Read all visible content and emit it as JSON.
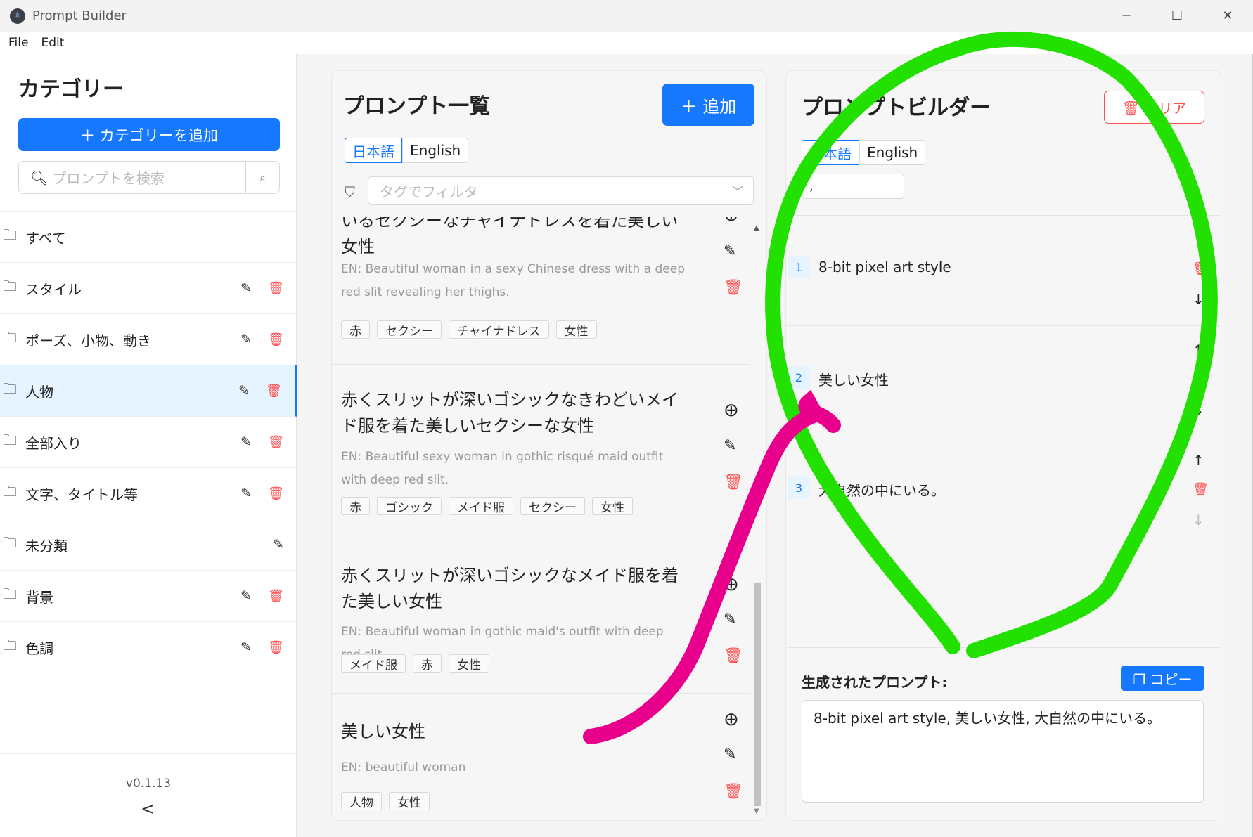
{
  "window": {
    "title": "Prompt Builder",
    "min": "─",
    "max": "☐",
    "close": "✕"
  },
  "menu": [
    "File",
    "Edit"
  ],
  "sidebar": {
    "title": "カテゴリー",
    "add_label": "＋ カテゴリーを追加",
    "search_placeholder": "プロンプトを検索",
    "categories": [
      {
        "name": "すべて",
        "edit": false,
        "del": false
      },
      {
        "name": "スタイル",
        "edit": true,
        "del": true
      },
      {
        "name": "ポーズ、小物、動き",
        "edit": true,
        "del": true
      },
      {
        "name": "人物",
        "edit": true,
        "del": true
      },
      {
        "name": "全部入り",
        "edit": true,
        "del": true
      },
      {
        "name": "文字、タイトル等",
        "edit": true,
        "del": true
      },
      {
        "name": "未分類",
        "edit": true,
        "del": false
      },
      {
        "name": "背景",
        "edit": true,
        "del": true
      },
      {
        "name": "色調",
        "edit": true,
        "del": true
      }
    ],
    "version": "v0.1.13",
    "collapse": "<"
  },
  "prompt_list": {
    "title": "プロンプト一覧",
    "add_label": "＋ 追加",
    "lang_jp": "日本語",
    "lang_en": "English",
    "filter_placeholder": "タグでフィルタ",
    "items": [
      {
        "jp": "いるセクシーなチャイナドレスを着た美しい女性",
        "en": "EN: Beautiful woman in a sexy Chinese dress with a deep red slit revealing her thighs.",
        "tags": [
          "赤",
          "セクシー",
          "チャイナドレス",
          "女性"
        ]
      },
      {
        "jp": "赤くスリットが深いゴシックなきわどいメイド服を着た美しいセクシーな女性",
        "en": "EN: Beautiful sexy woman in gothic risqué maid outfit with deep red slit.",
        "tags": [
          "赤",
          "ゴシック",
          "メイド服",
          "セクシー",
          "女性"
        ]
      },
      {
        "jp": "赤くスリットが深いゴシックなメイド服を着た美しい女性",
        "en": "EN: Beautiful woman in gothic maid's outfit with deep red slit",
        "tags": [
          "メイド服",
          "赤",
          "女性"
        ]
      },
      {
        "jp": "美しい女性",
        "en": "EN: beautiful woman",
        "tags": [
          "人物",
          "女性"
        ]
      }
    ]
  },
  "builder": {
    "title": "プロンプトビルダー",
    "clear_label": "🗑 クリア",
    "lang_jp": "日本語",
    "lang_en": "English",
    "separator": ",",
    "items": [
      {
        "num": "1",
        "text": "8-bit pixel art style"
      },
      {
        "num": "2",
        "text": "美しい女性"
      },
      {
        "num": "3",
        "text": "大自然の中にいる。"
      }
    ],
    "generated_label": "生成されたプロンプト:",
    "copy_label": "❐ コピー",
    "generated_text": "8-bit pixel art style, 美しい女性, 大自然の中にいる。"
  },
  "colors": {
    "primary": "#1677ff",
    "danger": "#ff4d4f",
    "green_stroke": "#22e000",
    "pink_stroke": "#e8008c"
  }
}
